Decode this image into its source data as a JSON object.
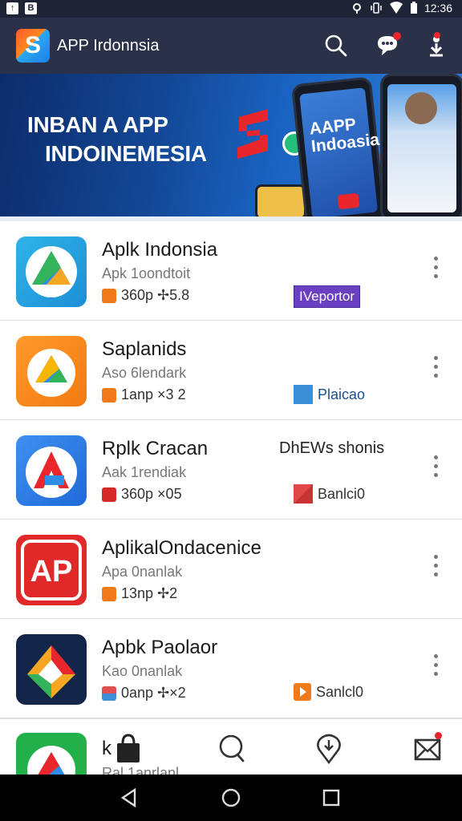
{
  "status_bar": {
    "left_icons": [
      "notification-icon",
      "b-icon"
    ],
    "left_glyphs": [
      "↑",
      "B"
    ],
    "right_icons": [
      "location-icon",
      "vibrate-icon",
      "wifi-icon",
      "battery-icon"
    ],
    "time": "12:36"
  },
  "app_bar": {
    "logo_letter": "S",
    "title": "APP Irdonnsia",
    "actions": [
      "search-icon",
      "chat-icon",
      "user-download-icon"
    ]
  },
  "banner": {
    "title_line1": "INBAN A APP",
    "title_line2": "INDOINEMESIA",
    "phone_text_line1": "AAPP",
    "phone_text_line2": "Indoasia",
    "brand_letter": "S"
  },
  "apps": [
    {
      "title": "Aplk Indonsia",
      "subtitle": "Apk 1oondtoit",
      "meta": "360p ✢5.8",
      "meta_badge_color": "#f07a1a",
      "extra": "",
      "tag": "IVeportor",
      "tag_type": "purple",
      "tag_color": "#6a3fc2"
    },
    {
      "title": "Saplanids",
      "subtitle": "Aso 6lendark",
      "meta": "1anp ×3 2",
      "meta_badge_color": "#f07a1a",
      "extra": "",
      "tag": "Plaicao",
      "tag_type": "square",
      "tag_color": "#3a8fd6"
    },
    {
      "title": "Rplk Cracan",
      "subtitle": "Aak 1rendiak",
      "meta": "360p ×05",
      "meta_badge_color": "#d62a2a",
      "extra": "DhEWs shonis",
      "tag": "Banlci0",
      "tag_type": "square",
      "tag_color": "#e04848"
    },
    {
      "title": "AplikalOndacenice",
      "subtitle": "Apa 0nanlak",
      "meta": "13np ✢2",
      "meta_badge_color": "#f07a1a",
      "extra": "",
      "tag": "",
      "tag_type": "none",
      "tag_color": ""
    },
    {
      "title": "Apbk Paolaor",
      "subtitle": "Kao 0nanlak",
      "meta": "0anp ✢×2",
      "meta_badge_color": "#e05050",
      "extra": "",
      "tag": "Sanlcl0",
      "tag_type": "square",
      "tag_color": "#f07a1a"
    }
  ],
  "peek_item": {
    "title": "k",
    "subtitle": "Ral 1anrlanl"
  },
  "bottom_nav": [
    "shopping-bag-icon",
    "search-icon",
    "location-pin-icon",
    "mail-icon"
  ],
  "system_nav": [
    "back-icon",
    "home-icon",
    "recents-icon"
  ]
}
